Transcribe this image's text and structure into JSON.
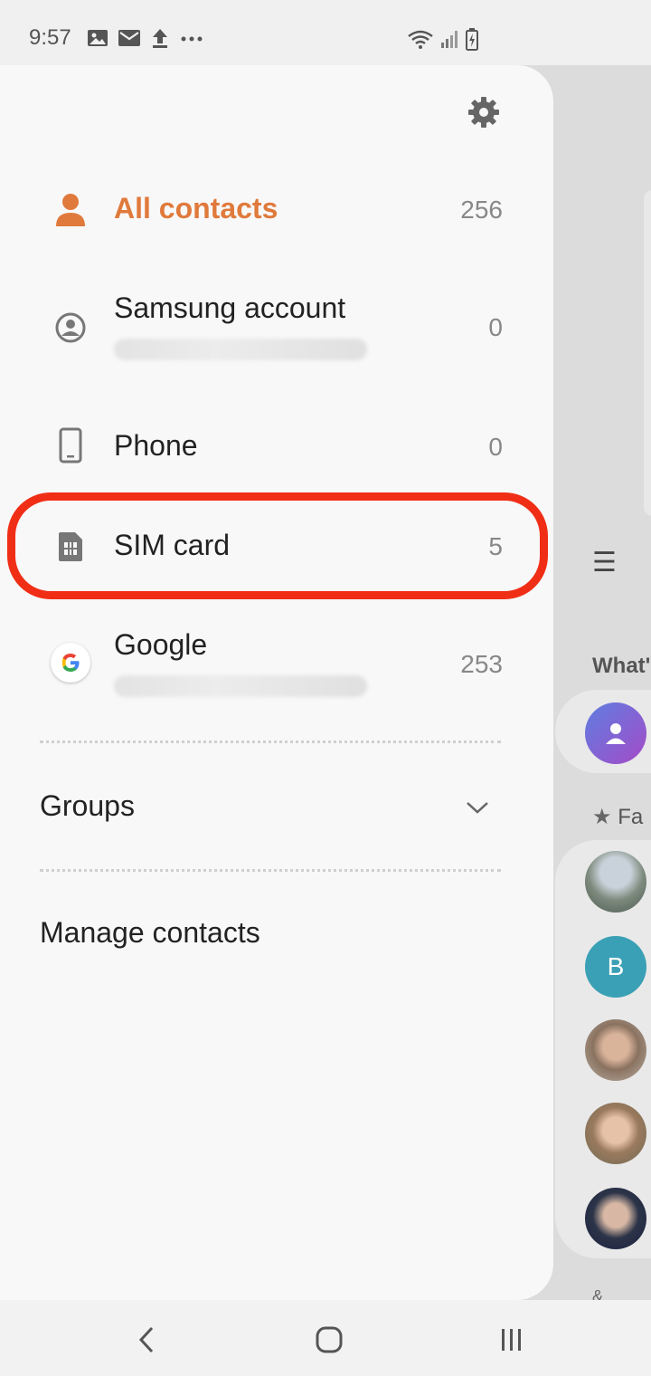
{
  "status_bar": {
    "time": "9:57",
    "left_icons": [
      "gallery-icon",
      "email-icon",
      "upload-icon",
      "more-icon"
    ],
    "right_icons": [
      "wifi-icon",
      "signal-icon",
      "battery-icon"
    ]
  },
  "drawer": {
    "accent_color": "#e07a3c",
    "items": [
      {
        "label": "All contacts",
        "count": "256",
        "icon": "person-icon",
        "active": true
      },
      {
        "label": "Samsung account",
        "count": "0",
        "icon": "samsung-account-icon"
      },
      {
        "label": "Phone",
        "count": "0",
        "icon": "phone-icon"
      },
      {
        "label": "SIM card",
        "count": "5",
        "icon": "sim-card-icon"
      },
      {
        "label": "Google",
        "count": "253",
        "icon": "google-icon"
      }
    ],
    "groups_label": "Groups",
    "manage_label": "Manage contacts",
    "highlight_color": "#f02e16"
  },
  "background_app": {
    "whats_label": "What'",
    "favorites_label": "Fa",
    "avatar_b_letter": "B",
    "amp_label": "&"
  },
  "nav_bar": {
    "icons": [
      "back-icon",
      "home-icon",
      "recents-icon"
    ]
  }
}
